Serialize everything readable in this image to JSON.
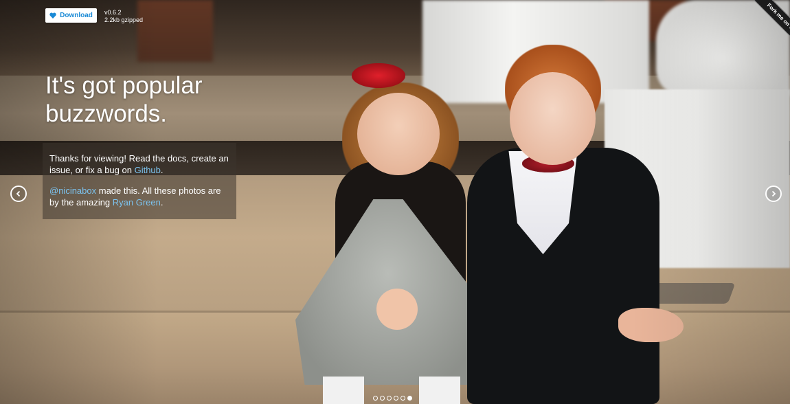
{
  "toolbar": {
    "download_label": "Download",
    "version": "v0.6.2",
    "size": "2.2kb gzipped"
  },
  "slide": {
    "headline_line1": "It's got popular",
    "headline_line2": "buzzwords.",
    "info": {
      "p1_text": "Thanks for viewing! Read the docs, create an issue, or fix a bug on ",
      "p1_link": "Github",
      "p1_end": ".",
      "p2_link1": "@nicinabox",
      "p2_text": " made this. All these photos are by the amazing ",
      "p2_link2": "Ryan Green",
      "p2_end": "."
    }
  },
  "ribbon": {
    "label": "Fork me on GitHub"
  },
  "pagination": {
    "count": 6,
    "active_index": 5
  },
  "colors": {
    "link": "#7cc3ef",
    "button_text": "#1a8ad6"
  },
  "icons": {
    "download": "heart-icon",
    "prev": "chevron-left-icon",
    "next": "chevron-right-icon"
  }
}
